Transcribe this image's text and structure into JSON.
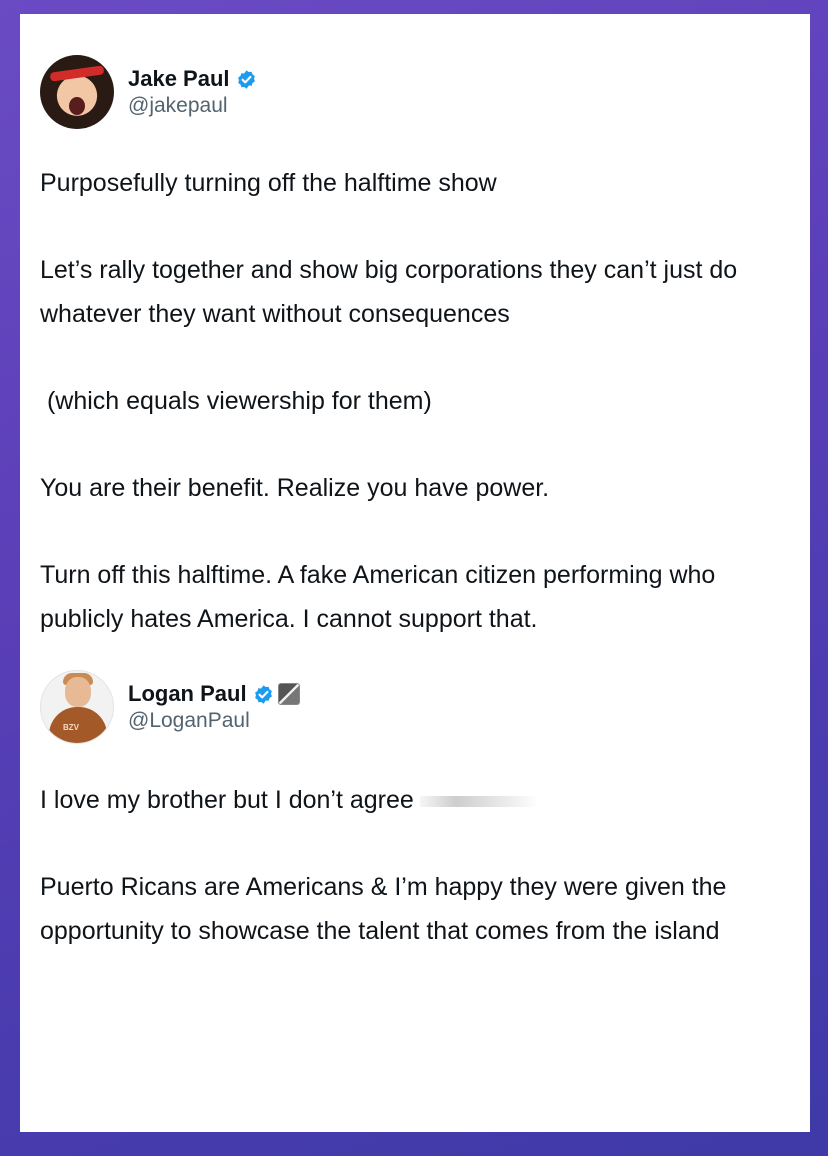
{
  "tweets": [
    {
      "name": "Jake Paul",
      "handle": "@jakepaul",
      "verified": true,
      "paragraphs": [
        "Purposefully turning off the halftime show",
        "Let’s rally together and show big corporations they can’t just do whatever they want without consequences",
        " (which equals viewership for them)",
        "You are their benefit. Realize you have power.",
        "Turn off this halftime. A fake American citizen performing who publicly hates America. I cannot support that."
      ]
    },
    {
      "name": "Logan Paul",
      "handle": "@LoganPaul",
      "verified": true,
      "affiliate_badge_icon": "affiliate-badge-icon",
      "paragraphs": [
        "I love my brother but I don’t agree",
        "Puerto Ricans are Americans & I’m happy they were given the opportunity to showcase the talent that comes from the island"
      ]
    }
  ],
  "colors": {
    "background_gradient_start": "#6a4bc4",
    "background_gradient_end": "#3f3aa8",
    "verified_blue": "#1d9bf0",
    "text": "#0f1419",
    "handle": "#536471"
  }
}
